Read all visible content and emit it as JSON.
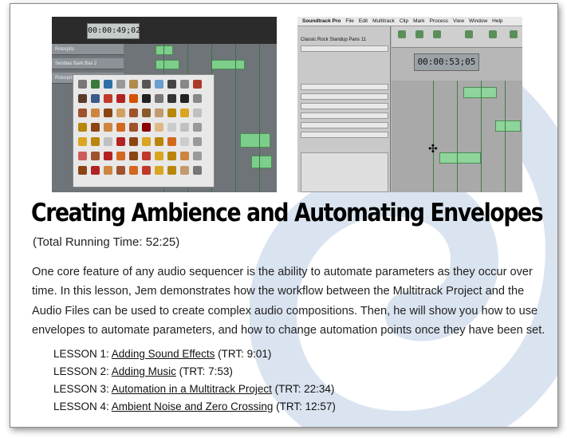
{
  "left_screenshot": {
    "lcd_time": "00:00:49;02",
    "track_labels": [
      "Rotorpits",
      "Sentilas Bark Bas 2",
      "Rotorpits"
    ]
  },
  "right_screenshot": {
    "menu": [
      "Soundtrack Pro",
      "File",
      "Edit",
      "Multitrack",
      "Clip",
      "Mark",
      "Process",
      "View",
      "Window",
      "Help"
    ],
    "lcd_time": "00:00:53;05",
    "inspector_title": "Classic Rock Standup Pans 11"
  },
  "title": "Creating Ambience and Automating Envelopes",
  "subtitle": "(Total Running Time: 52:25)",
  "body": "One core feature of any audio sequencer is the ability to automate parameters as they occur over time.  In this lesson, Jem demonstrates how the workflow between the Multitrack Project and the Audio Files can be used to create complex audio compositions.  Then, he will show you how to use envelopes to automate parameters, and how to change automation points once they have been set.",
  "lessons": [
    {
      "prefix": "LESSON 1: ",
      "link": "Adding Sound Effects",
      "trt": " (TRT: 9:01)"
    },
    {
      "prefix": "LESSON 2: ",
      "link": "Adding Music",
      "trt": " (TRT: 7:53)"
    },
    {
      "prefix": "LESSON 3: ",
      "link": "Automation in a Multitrack Project",
      "trt": " (TRT: 22:34)"
    },
    {
      "prefix": "LESSON 4: ",
      "link": "Ambient Noise and Zero Crossing",
      "trt": " (TRT: 12:57)"
    }
  ],
  "colors": {
    "link": "#111111",
    "clip_green": "#7ccf8a"
  }
}
